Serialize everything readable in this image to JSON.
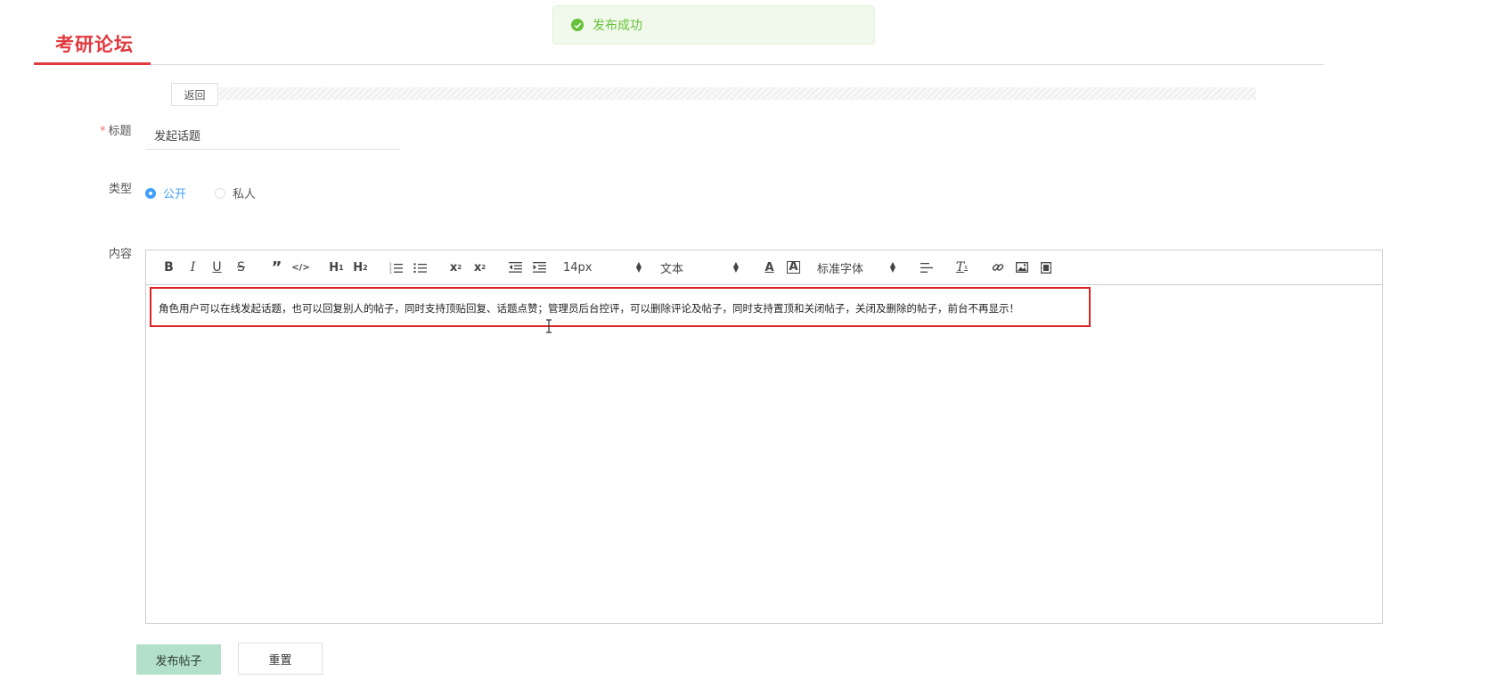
{
  "toast": {
    "message": "发布成功",
    "color": "#67c23a"
  },
  "header": {
    "brand": "考研论坛",
    "accent": "#e0393e"
  },
  "back_button": "返回",
  "form": {
    "title_label": "标题",
    "title_required_mark": "*",
    "title_value": "发起话题",
    "type_label": "类型",
    "type_options": [
      {
        "label": "公开",
        "checked": true
      },
      {
        "label": "私人",
        "checked": false
      }
    ],
    "content_label": "内容"
  },
  "editor": {
    "toolbar": {
      "font_size": "14px",
      "block_format": "文本",
      "font_family": "标准字体",
      "icons": [
        "bold-icon",
        "italic-icon",
        "underline-icon",
        "strike-icon",
        "blockquote-icon",
        "code-block-icon",
        "h1-icon",
        "h2-icon",
        "ordered-list-icon",
        "bullet-list-icon",
        "subscript-icon",
        "superscript-icon",
        "outdent-icon",
        "indent-icon",
        "font-color-icon",
        "background-color-icon",
        "align-icon",
        "clear-format-icon",
        "link-icon",
        "image-icon",
        "video-icon"
      ]
    },
    "content": "角色用户可以在线发起话题，也可以回复别人的帖子，同时支持顶贴回复、话题点赞；管理员后台控评，可以删除评论及帖子，同时支持置顶和关闭帖子，关闭及删除的帖子，前台不再显示！"
  },
  "actions": {
    "submit": "发布帖子",
    "reset": "重置"
  },
  "colors": {
    "primary": "#409eff",
    "submit_bg": "#b3e0c9",
    "highlight": "#e02020"
  }
}
